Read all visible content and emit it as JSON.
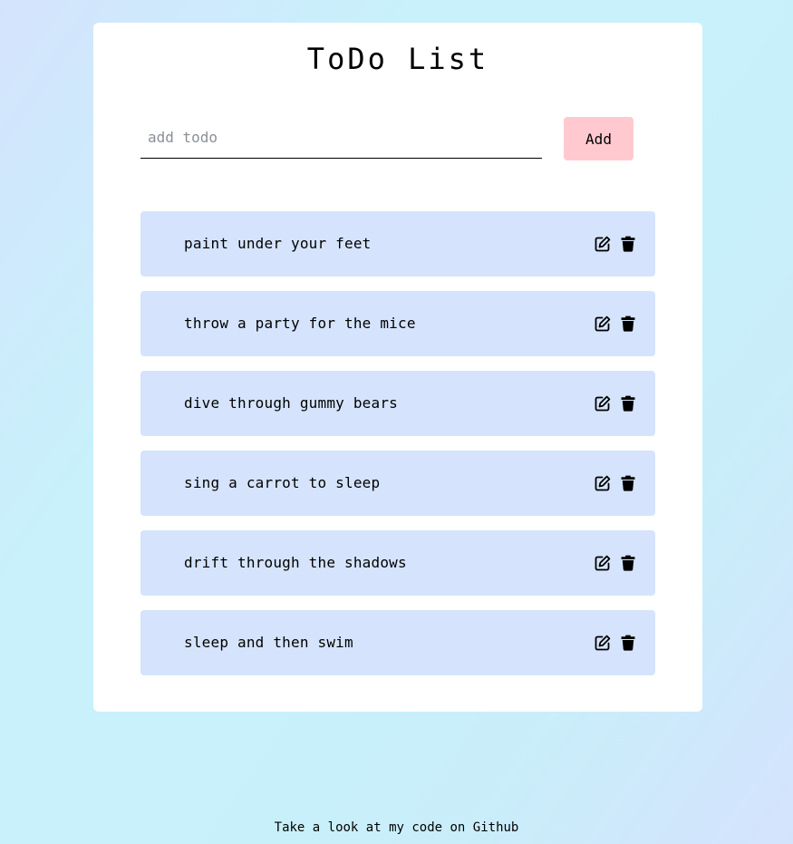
{
  "app": {
    "title": "ToDo List"
  },
  "form": {
    "placeholder": "add todo",
    "value": "",
    "add_label": "Add"
  },
  "todos": [
    {
      "text": "paint under your feet"
    },
    {
      "text": "throw a party for the mice"
    },
    {
      "text": "dive through gummy bears"
    },
    {
      "text": "sing a carrot to sleep"
    },
    {
      "text": "drift through the shadows"
    },
    {
      "text": "sleep and then swim"
    }
  ],
  "icons": {
    "edit": "edit-icon",
    "delete": "trash-icon"
  },
  "footer": {
    "link_text": "Take a look at my code on Github"
  },
  "colors": {
    "card": "#ffffff",
    "item_background": "#d5e4fc",
    "add_button": "#ffc9cf",
    "page_gradient_start": "#d4e3fc",
    "page_gradient_mid": "#c8f1fb"
  }
}
